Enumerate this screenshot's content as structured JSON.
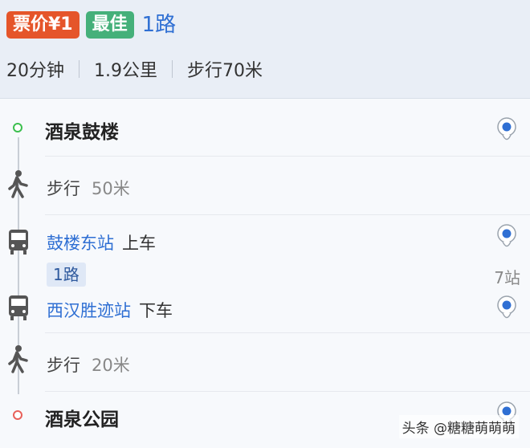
{
  "header": {
    "fare_tag": "票价¥1",
    "best_tag": "最佳",
    "route_name": "1路",
    "duration": "20分钟",
    "distance": "1.9公里",
    "walk": "步行70米"
  },
  "steps": {
    "start": {
      "name": "酒泉鼓楼",
      "icon": "start-dot-icon",
      "pin_icon": "map-pin-icon"
    },
    "walk1": {
      "label": "步行",
      "distance": "50米",
      "icon": "walk-icon"
    },
    "board": {
      "station": "鼓楼东站",
      "action": "上车",
      "icon": "bus-icon"
    },
    "line": {
      "badge": "1路",
      "stops": "7站"
    },
    "alight": {
      "station": "西汉胜迹站",
      "action": "下车",
      "icon": "bus-icon"
    },
    "walk2": {
      "label": "步行",
      "distance": "20米",
      "icon": "walk-icon"
    },
    "end": {
      "name": "酒泉公园",
      "icon": "end-dot-icon"
    }
  },
  "watermark": "头条 @糖糖萌萌萌",
  "colors": {
    "route_blue": "#2f6fd3",
    "fare_tag": "#e5552a",
    "best_tag": "#45b07a",
    "start_dot": "#3cbf4f",
    "end_dot": "#e8605a"
  }
}
